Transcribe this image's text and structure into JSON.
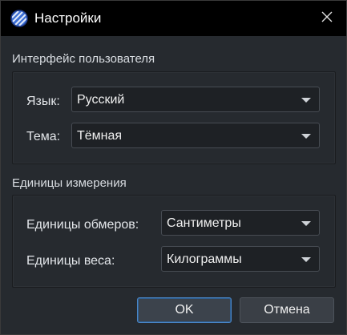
{
  "window": {
    "title": "Настройки",
    "app_icon": "planet-icon",
    "close_icon": "close-icon"
  },
  "interface_group": {
    "title": "Интерфейс пользователя",
    "language": {
      "label": "Язык:",
      "value": "Русский"
    },
    "theme": {
      "label": "Тема:",
      "value": "Тёмная"
    }
  },
  "units_group": {
    "title": "Единицы измерения",
    "measure_units": {
      "label": "Единицы обмеров:",
      "value": "Сантиметры"
    },
    "weight_units": {
      "label": "Единицы веса:",
      "value": "Килограммы"
    }
  },
  "buttons": {
    "ok": "OK",
    "cancel": "Отмена"
  },
  "colors": {
    "titlebar": "#000000",
    "background": "#262a2f",
    "accent": "#4a87c8"
  }
}
